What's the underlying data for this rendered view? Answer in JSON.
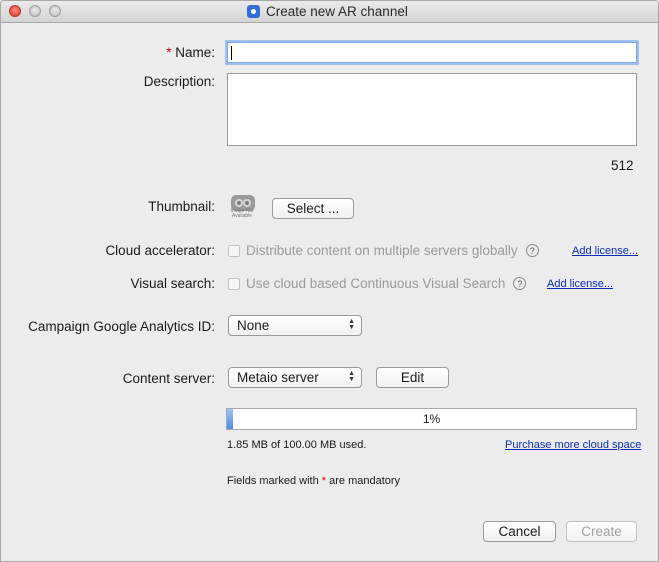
{
  "window": {
    "title": "Create new AR channel"
  },
  "form": {
    "name": {
      "required_mark": "*",
      "label": "Name:",
      "value": ""
    },
    "description": {
      "label": "Description:",
      "value": "",
      "remaining": "512"
    },
    "thumbnail": {
      "label": "Thumbnail:",
      "placeholder_caption": "Image Not Available",
      "select_label": "Select ..."
    },
    "cloud_accelerator": {
      "label": "Cloud accelerator:",
      "option_label": "Distribute content on multiple servers globally",
      "checked": false,
      "license_link": "Add license..."
    },
    "visual_search": {
      "label": "Visual search:",
      "option_label": "Use cloud based Continuous Visual Search",
      "checked": false,
      "license_link": "Add license..."
    },
    "analytics": {
      "label": "Campaign Google Analytics ID:",
      "selected": "None"
    },
    "content_server": {
      "label": "Content server:",
      "selected": "Metaio server",
      "edit_label": "Edit"
    }
  },
  "storage": {
    "percent_label": "1%",
    "progress": 0.01,
    "usage_text": "1.85 MB of 100.00 MB used.",
    "purchase_link": "Purchase more cloud space"
  },
  "footer": {
    "note_prefix": "Fields marked with",
    "note_mark": "*",
    "note_suffix": "are mandatory",
    "cancel_label": "Cancel",
    "create_label": "Create"
  },
  "colors": {
    "required": "#d0021b",
    "link": "#0a2db8",
    "progress": "#4c8fe2"
  }
}
